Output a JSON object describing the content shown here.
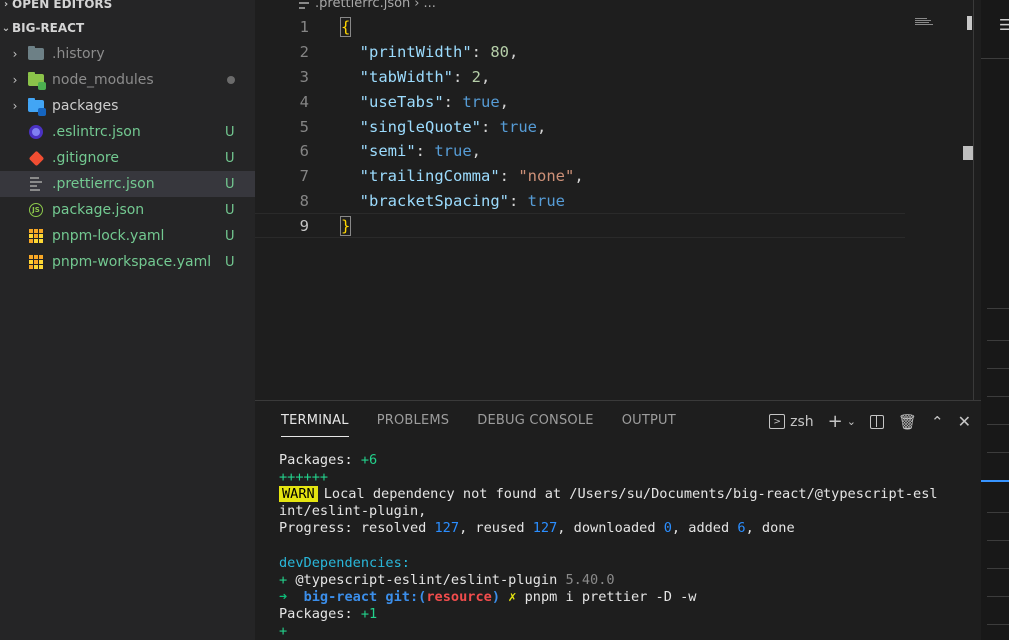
{
  "sidebar": {
    "open_editors": "OPEN EDITORS",
    "project": "BIG-REACT",
    "items": [
      {
        "label": ".history",
        "kind": "folder",
        "icon": "folder-icon",
        "badge": "",
        "status": "normal"
      },
      {
        "label": "node_modules",
        "kind": "folder",
        "icon": "node-folder-icon",
        "badge": "",
        "status": "ignored"
      },
      {
        "label": "packages",
        "kind": "folder",
        "icon": "packages-folder-icon",
        "badge": "",
        "status": "normal"
      },
      {
        "label": ".eslintrc.json",
        "kind": "file",
        "icon": "eslint-icon",
        "badge": "U",
        "status": "untracked"
      },
      {
        "label": ".gitignore",
        "kind": "file",
        "icon": "git-icon",
        "badge": "U",
        "status": "untracked"
      },
      {
        "label": ".prettierrc.json",
        "kind": "file",
        "icon": "prettier-icon",
        "badge": "U",
        "status": "untracked"
      },
      {
        "label": "package.json",
        "kind": "file",
        "icon": "nodejs-icon",
        "badge": "U",
        "status": "untracked"
      },
      {
        "label": "pnpm-lock.yaml",
        "kind": "file",
        "icon": "pnpm-icon",
        "badge": "U",
        "status": "untracked"
      },
      {
        "label": "pnpm-workspace.yaml",
        "kind": "file",
        "icon": "pnpm-icon",
        "badge": "U",
        "status": "untracked"
      }
    ]
  },
  "editor": {
    "breadcrumb": ".prettierrc.json",
    "breadcrumb_more": "...",
    "lines": [
      {
        "n": "1",
        "open": "{"
      },
      {
        "n": "2",
        "key": "\"printWidth\"",
        "val": "80",
        "type": "num",
        "comma": ","
      },
      {
        "n": "3",
        "key": "\"tabWidth\"",
        "val": "2",
        "type": "num",
        "comma": ","
      },
      {
        "n": "4",
        "key": "\"useTabs\"",
        "val": "true",
        "type": "kw",
        "comma": ","
      },
      {
        "n": "5",
        "key": "\"singleQuote\"",
        "val": "true",
        "type": "kw",
        "comma": ","
      },
      {
        "n": "6",
        "key": "\"semi\"",
        "val": "true",
        "type": "kw",
        "comma": ","
      },
      {
        "n": "7",
        "key": "\"trailingComma\"",
        "val": "\"none\"",
        "type": "str",
        "comma": ","
      },
      {
        "n": "8",
        "key": "\"bracketSpacing\"",
        "val": "true",
        "type": "kw",
        "comma": ""
      },
      {
        "n": "9",
        "close": "}"
      }
    ]
  },
  "panel": {
    "tabs": [
      "TERMINAL",
      "PROBLEMS",
      "DEBUG CONSOLE",
      "OUTPUT"
    ],
    "active_tab": "TERMINAL",
    "shell": "zsh"
  },
  "terminal": {
    "packages_label": "Packages: ",
    "packages_count_1": "+6",
    "plus_bar": "++++++",
    "warn_badge": "WARN",
    "warn_msg_1": "Local dependency not found at /Users/su/Documents/big-react/@typescript-esl",
    "warn_msg_2": "int/eslint-plugin,",
    "progress_prefix": "Progress: resolved ",
    "resolved": "127",
    "reused_label": ", reused ",
    "reused": "127",
    "downloaded_label": ", downloaded ",
    "downloaded": "0",
    "added_label": ", added ",
    "added": "6",
    "done_label": ", done",
    "dev_deps": "devDependencies:",
    "dep_plus": "+",
    "dep_name": "@typescript-eslint/eslint-plugin",
    "dep_version": "5.40.0",
    "prompt_arrow": "➜",
    "prompt_dir": "big-react",
    "prompt_git": "git:(",
    "prompt_branch": "resource",
    "prompt_git_close": ")",
    "prompt_dirty": "✗",
    "prompt_cmd": "pnpm i prettier -D -w",
    "packages_count_2": "+1",
    "last_plus": "+"
  }
}
